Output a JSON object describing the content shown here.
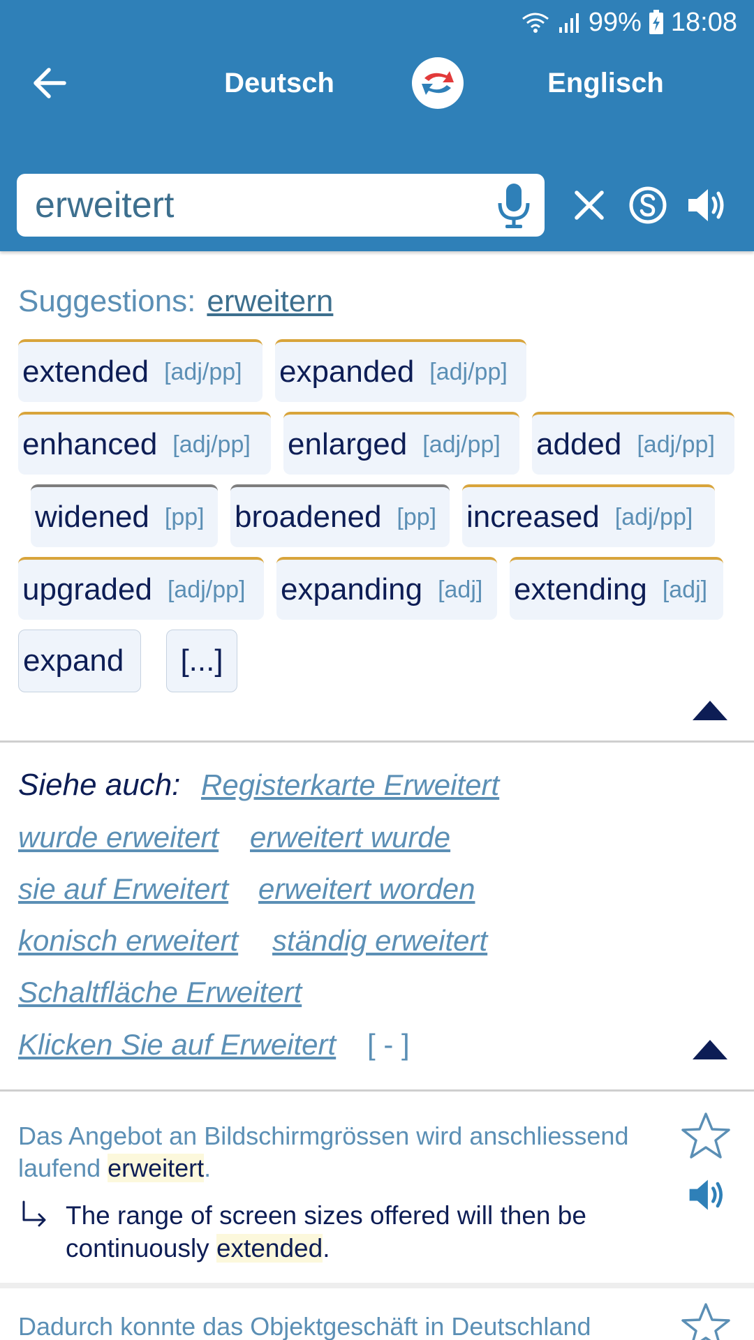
{
  "status_bar": {
    "battery": "99%",
    "time": "18:08"
  },
  "header": {
    "source_language": "Deutsch",
    "target_language": "Englisch",
    "search": {
      "value": "erweitert"
    }
  },
  "suggestions": {
    "label": "Suggestions:",
    "link": "erweitern"
  },
  "translations": [
    {
      "word": "extended",
      "tag": "[adj/pp]"
    },
    {
      "word": "expanded",
      "tag": "[adj/pp]"
    },
    {
      "word": "enhanced",
      "tag": "[adj/pp]"
    },
    {
      "word": "enlarged",
      "tag": "[adj/pp]"
    },
    {
      "word": "added",
      "tag": "[adj/pp]"
    },
    {
      "word": "widened",
      "tag": "[pp]"
    },
    {
      "word": "broadened",
      "tag": "[pp]"
    },
    {
      "word": "increased",
      "tag": "[adj/pp]"
    },
    {
      "word": "upgraded",
      "tag": "[adj/pp]"
    },
    {
      "word": "expanding",
      "tag": "[adj]"
    },
    {
      "word": "extending",
      "tag": "[adj]"
    },
    {
      "word": "expand",
      "tag": ""
    },
    {
      "word": "[...]",
      "tag": ""
    }
  ],
  "see_also": {
    "label": "Siehe auch:",
    "links": [
      "Registerkarte Erweitert",
      "wurde erweitert",
      "erweitert wurde",
      "sie auf Erweitert",
      "erweitert worden",
      "konisch erweitert",
      "ständig erweitert",
      "Schaltfläche Erweitert",
      "Klicken Sie auf Erweitert"
    ],
    "collapse": "[ - ]"
  },
  "examples": [
    {
      "de_before": "Das Angebot an Bildschirmgrössen wird anschliessend laufend ",
      "de_highlight": "erweitert",
      "de_after": ".",
      "en_before": "The range of screen sizes offered will then be continuously ",
      "en_highlight": "extended",
      "en_after": "."
    },
    {
      "de_before": "Dadurch konnte das Objektgeschäft in Deutschland",
      "de_highlight": "",
      "de_after": ""
    }
  ],
  "colors": {
    "header_bg": "#2f80b8",
    "chip_bg": "#eff4fb",
    "chip_border_gold": "#d8a43b",
    "chip_border_grey": "#7d7d7d",
    "dark_text": "#0d1d55",
    "link_text": "#5b8fb5",
    "highlight": "#fcf8dc"
  },
  "icons": {
    "back": "arrow-left-icon",
    "swap": "swap-languages-icon",
    "mic": "microphone-icon",
    "clear": "close-icon",
    "s": "s-circle-icon",
    "speaker": "speaker-icon",
    "collapse": "triangle-up-icon",
    "star": "star-outline-icon",
    "return": "return-arrow-icon"
  }
}
